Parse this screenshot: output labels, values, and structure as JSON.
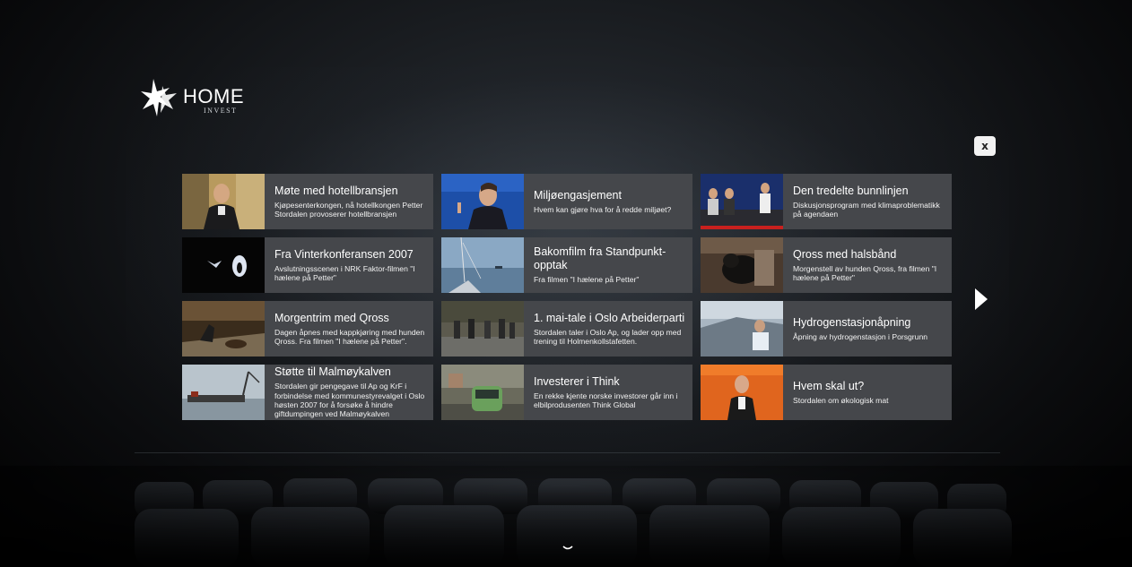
{
  "brand": {
    "name": "HOME",
    "sub": "INVEST"
  },
  "close_label": "x",
  "videos": [
    {
      "title": "Møte med hotellbransjen",
      "desc": "Kjøpesenterkongen, nå hotellkongen Petter Stordalen provoserer hotellbransjen"
    },
    {
      "title": "Miljøengasjement",
      "desc": "Hvem kan gjøre hva for å redde miljøet?"
    },
    {
      "title": "Den tredelte bunnlinjen",
      "desc": "Diskusjonsprogram med klimaproblematikk på agendaen"
    },
    {
      "title": "Fra Vinterkonferansen 2007",
      "desc": "Avslutningsscenen i NRK Faktor-filmen \"I hælene på Petter\""
    },
    {
      "title": "Bakomfilm fra Standpunkt-opptak",
      "desc": "Fra filmen \"I hælene på Petter\""
    },
    {
      "title": "Qross med halsbånd",
      "desc": "Morgenstell av hunden Qross, fra filmen \"I hælene på Petter\""
    },
    {
      "title": "Morgentrim med Qross",
      "desc": "Dagen åpnes med kappkjøring med hunden Qross. Fra filmen \"I hælene på Petter\"."
    },
    {
      "title": "1. mai-tale i Oslo Arbeiderparti",
      "desc": "Stordalen taler i Oslo Ap, og lader opp med trening til Holmenkollstafetten."
    },
    {
      "title": "Hydrogenstasjonåpning",
      "desc": "Åpning av hydrogenstasjon i Porsgrunn"
    },
    {
      "title": "Støtte til Malmøykalven",
      "desc": "Stordalen gir pengegave til Ap og KrF i forbindelse med kommunestyrevalget i Oslo høsten 2007 for å forsøke å hindre giftdumpingen ved Malmøykalven"
    },
    {
      "title": "Investerer i Think",
      "desc": "En rekke kjente norske investorer går inn i elbilprodusenten Think Global"
    },
    {
      "title": "Hvem skal ut?",
      "desc": "Stordalen om økologisk mat"
    }
  ]
}
